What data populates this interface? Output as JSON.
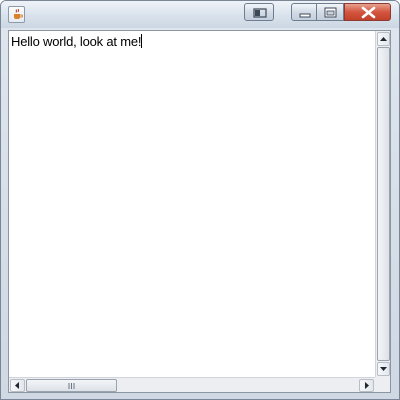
{
  "window": {
    "app_icon": "java-cup-icon",
    "buttons": {
      "extra": "restore-tile-icon",
      "minimize": "minimize-icon",
      "maximize": "maximize-icon",
      "close": "close-icon"
    }
  },
  "editor": {
    "text": "Hello world, look at me!"
  },
  "scrollbars": {
    "vertical": {
      "up": "arrow-up-icon",
      "down": "arrow-down-icon"
    },
    "horizontal": {
      "left": "arrow-left-icon",
      "right": "arrow-right-icon",
      "grip": "grip-icon"
    }
  },
  "colors": {
    "close_button": "#d4553f",
    "title_bar": "#dfe6ee"
  }
}
